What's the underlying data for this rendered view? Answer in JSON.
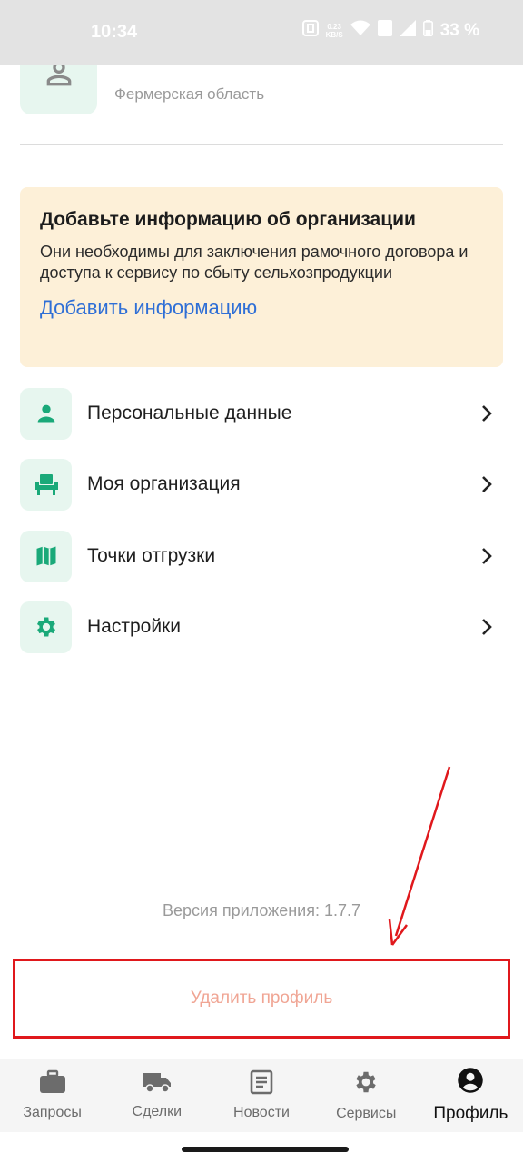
{
  "status_bar": {
    "time": "10:34",
    "speed_value": "0.23",
    "speed_unit": "KB/S",
    "battery": "33 %"
  },
  "profile": {
    "region": "Фермерская область"
  },
  "org_card": {
    "title": "Добавьте информацию об организации",
    "description": "Они необходимы для заключения рамочного договора и доступа к сервису по сбыту сельхозпродукции",
    "link": "Добавить информацию",
    "background": "#fdf0d8",
    "link_color": "#2f6fd6"
  },
  "menu": [
    {
      "label": "Персональные данные",
      "icon": "person-icon"
    },
    {
      "label": "Моя организация",
      "icon": "organization-icon"
    },
    {
      "label": "Точки отгрузки",
      "icon": "map-icon"
    },
    {
      "label": "Настройки",
      "icon": "gear-icon"
    }
  ],
  "version": "Версия приложения: 1.7.7",
  "delete_profile": "Удалить профиль",
  "bottom_nav": [
    {
      "label": "Запросы",
      "icon": "briefcase-icon"
    },
    {
      "label": "Сделки",
      "icon": "truck-icon"
    },
    {
      "label": "Новости",
      "icon": "news-icon"
    },
    {
      "label": "Сервисы",
      "icon": "gear-icon"
    },
    {
      "label": "Профиль",
      "icon": "account-circle-icon",
      "active": true
    }
  ],
  "colors": {
    "accent_green": "#1aa979",
    "icon_bg": "#e7f6ef",
    "annotation_red": "#e0181c",
    "delete_text": "#f0a594"
  }
}
